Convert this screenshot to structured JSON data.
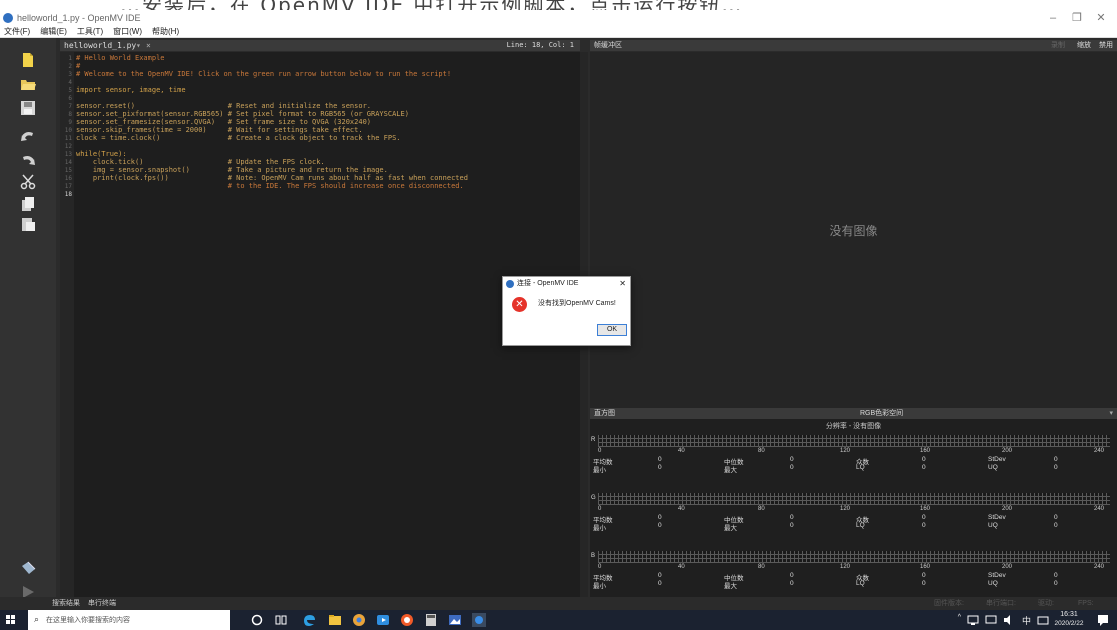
{
  "caption": {
    "text": "…安装后，在 OpenMV IDE 中打开示例脚本，点击运行按钮…"
  },
  "window": {
    "title": "helloworld_1.py - OpenMV IDE",
    "minimize": "–",
    "restore": "❐",
    "close": "✕"
  },
  "menubar": {
    "items": [
      "文件(F)",
      "编辑(E)",
      "工具(T)",
      "窗口(W)",
      "帮助(H)"
    ]
  },
  "editor": {
    "tab_name": "helloworld_1.py",
    "tab_dropdown": "▾",
    "tab_close": "×",
    "cursor_pos": "Line: 18, Col: 1",
    "line_numbers": [
      "1",
      "2",
      "3",
      "4",
      "5",
      "6",
      "7",
      "8",
      "9",
      "10",
      "11",
      "12",
      "13",
      "14",
      "15",
      "16",
      "17",
      "18"
    ],
    "lines": [
      "# Hello World Example",
      "#",
      "# Welcome to the OpenMV IDE! Click on the green run arrow button below to run the script!",
      "",
      "import sensor, image, time",
      "",
      "sensor.reset()                      # Reset and initialize the sensor.",
      "sensor.set_pixformat(sensor.RGB565) # Set pixel format to RGB565 (or GRAYSCALE)",
      "sensor.set_framesize(sensor.QVGA)   # Set frame size to QVGA (320x240)",
      "sensor.skip_frames(time = 2000)     # Wait for settings take effect.",
      "clock = time.clock()                # Create a clock object to track the FPS.",
      "",
      "while(True):",
      "    clock.tick()                    # Update the FPS clock.",
      "    img = sensor.snapshot()         # Take a picture and return the image.",
      "    print(clock.fps())              # Note: OpenMV Cam runs about half as fast when connected",
      "                                    # to the IDE. The FPS should increase once disconnected.",
      ""
    ]
  },
  "framebuffer": {
    "title": "帧缓冲区",
    "record": "录制",
    "zoom": "缩放",
    "disable": "禁用",
    "no_image": "没有图像"
  },
  "histogram": {
    "title": "直方图",
    "color_space": "RGB色彩空间",
    "dropdown_arrow": "▾",
    "resolution": "分辨率 - 没有图像",
    "channels": [
      {
        "label": "R"
      },
      {
        "label": "G"
      },
      {
        "label": "B"
      }
    ],
    "axis_ticks": [
      "0",
      "40",
      "80",
      "120",
      "160",
      "200",
      "240"
    ],
    "stat_labels": {
      "mean": "平均数",
      "median": "中位数",
      "mode": "众数",
      "stdev": "StDev",
      "min": "最小",
      "max": "最大",
      "lq": "LQ",
      "uq": "UQ"
    },
    "stat_value": "0"
  },
  "statusbar": {
    "left": [
      "搜索结果",
      "串行终端"
    ],
    "right": [
      "固件版本:",
      "串行端口:",
      "驱动:",
      "FPS:"
    ]
  },
  "dialog": {
    "title": "连接 - OpenMV IDE",
    "close": "✕",
    "message": "没有找到OpenMV Cams!",
    "ok": "OK"
  },
  "taskbar": {
    "search_placeholder": "在这里输入你要搜索的内容",
    "search_icon": "⌕",
    "tray_chevron": "^",
    "tray_input": "中",
    "time": "16:31",
    "date": "2020/2/22"
  },
  "colors": {
    "editor_bg": "#1e1e1e",
    "comment": "#c9783a",
    "code": "#c9a15a",
    "taskbar": "#1b2230",
    "error": "#e5332a",
    "accent": "#2f6fc0"
  }
}
